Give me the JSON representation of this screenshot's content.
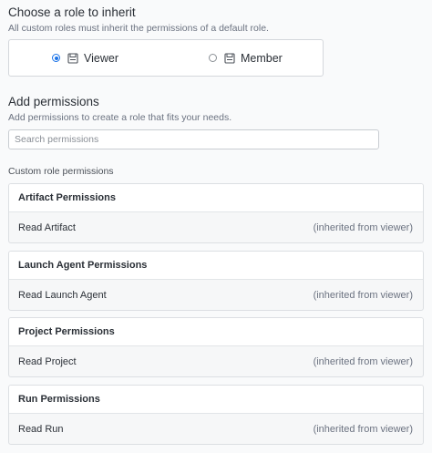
{
  "inherit": {
    "title": "Choose a role to inherit",
    "subtitle": "All custom roles must inherit the permissions of a default role.",
    "options": [
      {
        "label": "Viewer",
        "selected": true
      },
      {
        "label": "Member",
        "selected": false
      }
    ],
    "accent_color": "#1a73e8"
  },
  "add_permissions": {
    "title": "Add permissions",
    "subtitle": "Add permissions to create a role that fits your needs.",
    "search_placeholder": "Search permissions"
  },
  "custom_permissions": {
    "label": "Custom role permissions",
    "groups": [
      {
        "title": "Artifact Permissions",
        "items": [
          {
            "name": "Read Artifact",
            "note": "(inherited from viewer)"
          }
        ]
      },
      {
        "title": "Launch Agent Permissions",
        "items": [
          {
            "name": "Read Launch Agent",
            "note": "(inherited from viewer)"
          }
        ]
      },
      {
        "title": "Project Permissions",
        "items": [
          {
            "name": "Read Project",
            "note": "(inherited from viewer)"
          }
        ]
      },
      {
        "title": "Run Permissions",
        "items": [
          {
            "name": "Read Run",
            "note": "(inherited from viewer)"
          }
        ]
      }
    ]
  }
}
